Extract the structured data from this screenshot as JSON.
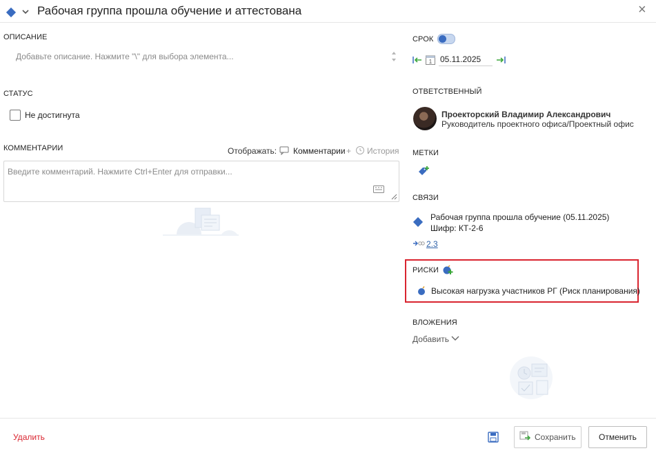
{
  "header": {
    "title": "Рабочая группа прошла обучение и аттестована"
  },
  "description": {
    "label": "ОПИСАНИЕ",
    "placeholder": "Добавьте описание. Нажмите \"\\\" для выбора элемента..."
  },
  "status": {
    "label": "СТАТУС",
    "checkbox_label": "Не достигнута"
  },
  "comments": {
    "label": "КОММЕНТАРИИ",
    "show_label": "Отображать:",
    "comments_option": "Комментарии",
    "plus": "+",
    "history_option": "История",
    "input_placeholder": "Введите комментарий. Нажмите Ctrl+Enter для отправки..."
  },
  "deadline": {
    "label": "СРОК",
    "date": "05.11.2025",
    "calendar_day": "1"
  },
  "responsible": {
    "label": "ОТВЕТСТВЕННЫЙ",
    "name": "Проекторский Владимир Александрович",
    "position": "Руководитель проектного офиса/Проектный офис"
  },
  "tags": {
    "label": "МЕТКИ"
  },
  "links": {
    "label": "СВЯЗИ",
    "item_title": "Рабочая группа прошла обучение (05.11.2025)",
    "item_code": "Шифр: КТ-2-6",
    "sub_link": "2.3"
  },
  "risks": {
    "label": "РИСКИ",
    "item": "Высокая нагрузка участников РГ (Риск планирования)"
  },
  "attachments": {
    "label": "ВЛОЖЕНИЯ",
    "add_label": "Добавить"
  },
  "footer": {
    "delete_label": "Удалить",
    "save_label": "Сохранить",
    "cancel_label": "Отменить"
  },
  "colors": {
    "accent": "#3a6cc0",
    "danger": "#d9232e",
    "arrow_green": "#3aa63a"
  }
}
